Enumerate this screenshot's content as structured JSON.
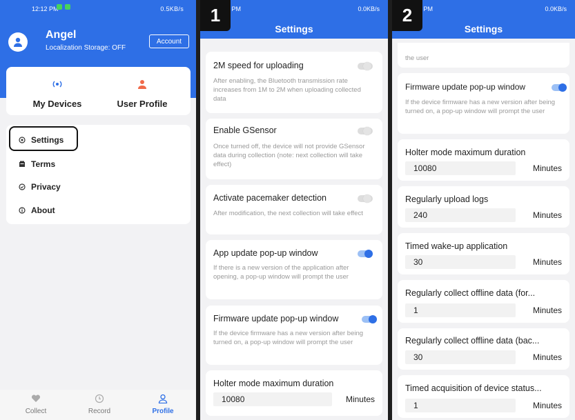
{
  "profile": {
    "status_time": "12:12 PM",
    "status_right": "0.5KB/s",
    "user_name": "Angel",
    "storage": "Localization Storage: OFF",
    "account_label": "Account",
    "devices_label": "My Devices",
    "user_profile_label": "User Profile",
    "menu": [
      {
        "label": "Settings",
        "icon": "settings-icon"
      },
      {
        "label": "Terms",
        "icon": "terms-icon"
      },
      {
        "label": "Privacy",
        "icon": "privacy-icon"
      },
      {
        "label": "About",
        "icon": "about-icon"
      }
    ],
    "tabs": [
      {
        "label": "Collect",
        "icon": "heart-icon",
        "active": false
      },
      {
        "label": "Record",
        "icon": "clock-icon",
        "active": false
      },
      {
        "label": "Profile",
        "icon": "person-icon",
        "active": true
      }
    ],
    "accent": "#2e6fe6"
  },
  "screen1": {
    "badge": "1",
    "status_time": "9 PM",
    "status_right": "0.0KB/s",
    "title": "Settings",
    "items": [
      {
        "title": "2M speed for uploading",
        "desc": "After enabling, the Bluetooth transmission rate increases from 1M to 2M when uploading collected data",
        "toggle": "off"
      },
      {
        "title": "Enable GSensor",
        "desc": "Once turned off, the device will not provide GSensor data during collection (note: next collection will take effect)",
        "toggle": "off"
      },
      {
        "title": "Activate pacemaker detection",
        "desc": "After modification, the next collection will take effect",
        "toggle": "off"
      },
      {
        "title": "App update pop-up window",
        "desc": "If there is a new version of the application after opening, a pop-up window will prompt the user",
        "toggle": "on"
      },
      {
        "title": "Firmware update pop-up window",
        "desc": "If the device firmware has a new version after being turned on, a pop-up window will prompt the user",
        "toggle": "on"
      },
      {
        "title": "Holter mode maximum duration",
        "value": "10080",
        "unit": "Minutes"
      }
    ]
  },
  "screen2": {
    "badge": "2",
    "status_time": "9 PM",
    "status_right": "0.0KB/s",
    "title": "Settings",
    "top_fragment": "the user",
    "items": [
      {
        "title": "Firmware update pop-up window",
        "desc": "If the device firmware has a new version after being turned on, a pop-up window will prompt the user",
        "toggle": "on"
      },
      {
        "title": "Holter mode maximum duration",
        "value": "10080",
        "unit": "Minutes"
      },
      {
        "title": "Regularly upload logs",
        "value": "240",
        "unit": "Minutes"
      },
      {
        "title": "Timed wake-up application",
        "value": "30",
        "unit": "Minutes"
      },
      {
        "title": "Regularly collect offline data (for...",
        "value": "1",
        "unit": "Minutes"
      },
      {
        "title": "Regularly collect offline data (bac...",
        "value": "30",
        "unit": "Minutes"
      },
      {
        "title": "Timed acquisition of device status...",
        "value": "1",
        "unit": "Minutes"
      }
    ]
  }
}
